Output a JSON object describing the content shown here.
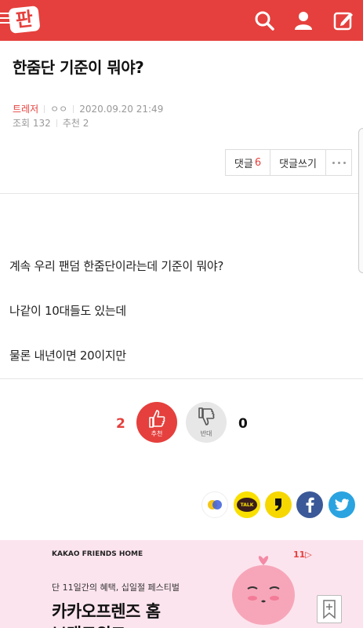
{
  "header": {
    "logo_text": "판",
    "brand_color": "#e5403d"
  },
  "article": {
    "title": "한줌단 기준이 뭐야?",
    "author": "트레저",
    "nickname": "ㅇㅇ",
    "datetime": "2020.09.20 21:49",
    "views_label": "조회 132",
    "recommend_label": "추천 2"
  },
  "buttons": {
    "comments_label": "댓글",
    "comments_count": "6",
    "write_comment_label": "댓글쓰기"
  },
  "body": {
    "paragraphs": [
      "계속 우리 팬덤 한줌단이라는데 기준이 뭐야?",
      "나같이 10대들도 있는데",
      "물론 내년이면 20이지만"
    ]
  },
  "votes": {
    "up_count": "2",
    "up_label": "추천",
    "down_label": "반대",
    "down_count": "0"
  },
  "share": {
    "kakaotalk_label": "TALK"
  },
  "ad": {
    "brand": "KAKAO FRIENDS HOME",
    "partner": "11▷",
    "line1": "단 11일간의 혜택, 십일절 페스티벌",
    "line2": "카카오프렌즈 홈",
    "line3": "브랜드위크"
  }
}
